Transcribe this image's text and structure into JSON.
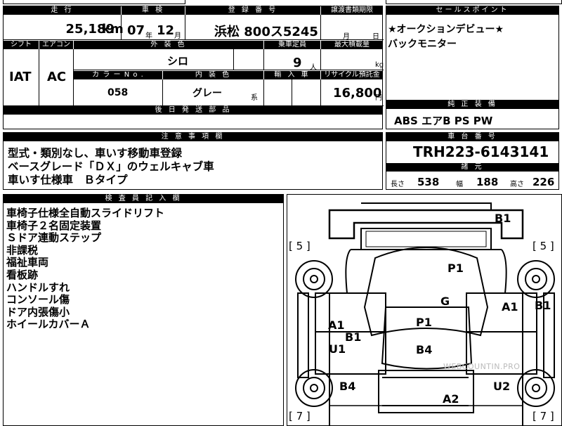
{
  "top": {
    "headers": {
      "mileage": "走 行",
      "inspection": "車 検",
      "reg": "登 録 番 号",
      "transfer": "譲渡書類期限",
      "sales": "セールスポイント"
    },
    "mileage_value": "25,189",
    "mileage_unit": "km",
    "inspection_year": "07",
    "year_unit": "年",
    "inspection_month": "12",
    "month_unit": "月",
    "plate": "浜松 800ス5245",
    "transfer_month": "月",
    "transfer_day": "日"
  },
  "mid": {
    "headers": {
      "shift": "シフト",
      "ac": "エアコン",
      "exterior": "外 装 色",
      "capacity": "乗車定員",
      "maxload": "最大積載量",
      "color_no": "カ ラ ー N o .",
      "interior": "内 装 色",
      "import": "輸 入 車",
      "recycle": "リサイクル預託金",
      "later_parts": "後 日 発 送 部 品"
    },
    "shift": "IAT",
    "ac": "AC",
    "exterior": "シロ",
    "capacity": "9",
    "capacity_unit": "人",
    "maxload_unit": "kg",
    "color_no": "058",
    "interior": "グレー",
    "interior_suffix": "系",
    "recycle": "16,800",
    "recycle_unit": "円"
  },
  "sales_points": {
    "lines": [
      "★オークションデビュー★",
      "バックモニター"
    ]
  },
  "equipment": {
    "header": "純 正 装 備",
    "value": "ABS エアB PS PW"
  },
  "cautions": {
    "header": "注 意 事 項 欄",
    "lines": [
      "型式・類別なし、車いす移動車登録",
      "ベースグレード「ＤＸ」のウェルキャブ車",
      "車いす仕様車　Ｂタイプ"
    ]
  },
  "chassis": {
    "header": "車 台 番 号",
    "value": "TRH223-6143141",
    "specs_header": "諸 元",
    "length_label": "長さ",
    "length": "538",
    "width_label": "幅",
    "width": "188",
    "height_label": "高さ",
    "height": "226"
  },
  "inspector": {
    "header": "検 査 員 記 入 欄",
    "lines": [
      "車椅子仕様全自動スライドリフト",
      "車椅子２名固定装置",
      "Ｓドア連動ステップ",
      "非課税",
      "福祉車両",
      "看板跡",
      "ハンドルすれ",
      "コンソール傷",
      "ドア内張傷小",
      "ホイールカバーＡ"
    ]
  },
  "diagram": {
    "marks": [
      "B1",
      "P1",
      "G",
      "A1",
      "B1",
      "A1",
      "P1",
      "B1",
      "U1",
      "B4",
      "B4",
      "U2",
      "A2"
    ],
    "tires": [
      "[ 5 ]",
      "[ 5 ]",
      "[ 7 ]",
      "[ 7 ]"
    ],
    "watermark": "WEBCOUNTIN.PRO"
  }
}
